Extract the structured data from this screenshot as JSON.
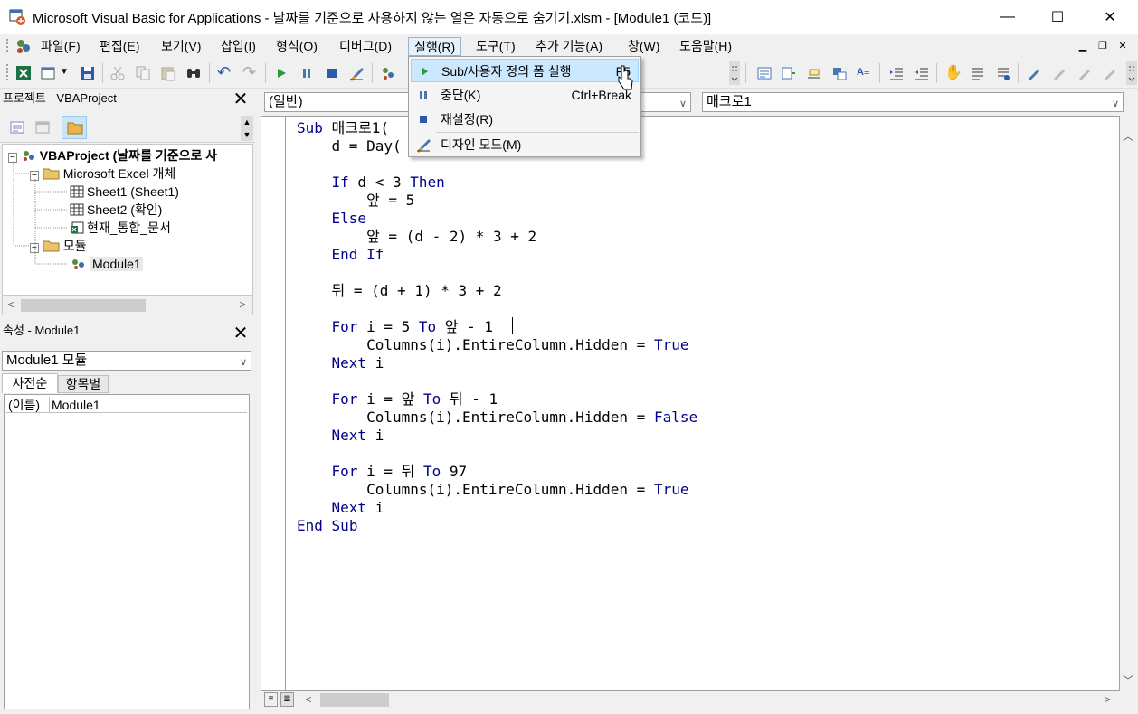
{
  "window": {
    "title": "Microsoft Visual Basic for Applications - 날짜를 기준으로 사용하지 않는 열은 자동으로 숨기기.xlsm - [Module1 (코드)]",
    "minimize": "—",
    "maximize": "☐",
    "close": "✕"
  },
  "menu": {
    "items": [
      "파일(F)",
      "편집(E)",
      "보기(V)",
      "삽입(I)",
      "형식(O)",
      "디버그(D)",
      "실행(R)",
      "도구(T)",
      "추가 기능(A)",
      "창(W)",
      "도움말(H)"
    ],
    "active_index": 6
  },
  "run_menu": {
    "items": [
      {
        "label": "Sub/사용자 정의 폼 실행",
        "shortcut": "F5",
        "icon": "play-icon"
      },
      {
        "label": "중단(K)",
        "shortcut": "Ctrl+Break",
        "icon": "pause-icon"
      },
      {
        "label": "재설정(R)",
        "shortcut": "",
        "icon": "stop-icon"
      },
      {
        "label": "디자인 모드(M)",
        "shortcut": "",
        "icon": "design-mode-icon"
      }
    ]
  },
  "project_panel": {
    "title": "프로젝트 - VBAProject",
    "tree": {
      "root": "VBAProject (날짜를 기준으로 사",
      "folder1": "Microsoft Excel 개체",
      "sheet1": "Sheet1 (Sheet1)",
      "sheet2": "Sheet2 (확인)",
      "workbook": "현재_통합_문서",
      "folder2": "모듈",
      "module": "Module1"
    }
  },
  "properties_panel": {
    "title": "속성 - Module1",
    "object_combo": "Module1 모듈",
    "tabs": [
      "사전순",
      "항목별"
    ],
    "rows": [
      {
        "name": "(이름)",
        "value": "Module1"
      }
    ]
  },
  "code_window": {
    "object_combo": "(일반)",
    "procedure_combo": "매크로1",
    "lines": [
      "Sub 매크로1(",
      "    d = Day(",
      "",
      "    If d < 3 Then",
      "        앞 = 5",
      "    Else",
      "        앞 = (d - 2) * 3 + 2",
      "    End If",
      "",
      "    뒤 = (d + 1) * 3 + 2",
      "",
      "    For i = 5 To 앞 - 1",
      "        Columns(i).EntireColumn.Hidden = True",
      "    Next i",
      "",
      "    For i = 앞 To 뒤 - 1",
      "        Columns(i).EntireColumn.Hidden = False",
      "    Next i",
      "",
      "    For i = 뒤 To 97",
      "        Columns(i).EntireColumn.Hidden = True",
      "    Next i",
      "End Sub"
    ]
  },
  "colors": {
    "keyword": "#00008b",
    "menu_highlight": "#cce8ff",
    "title_bar": "#ffffff"
  }
}
